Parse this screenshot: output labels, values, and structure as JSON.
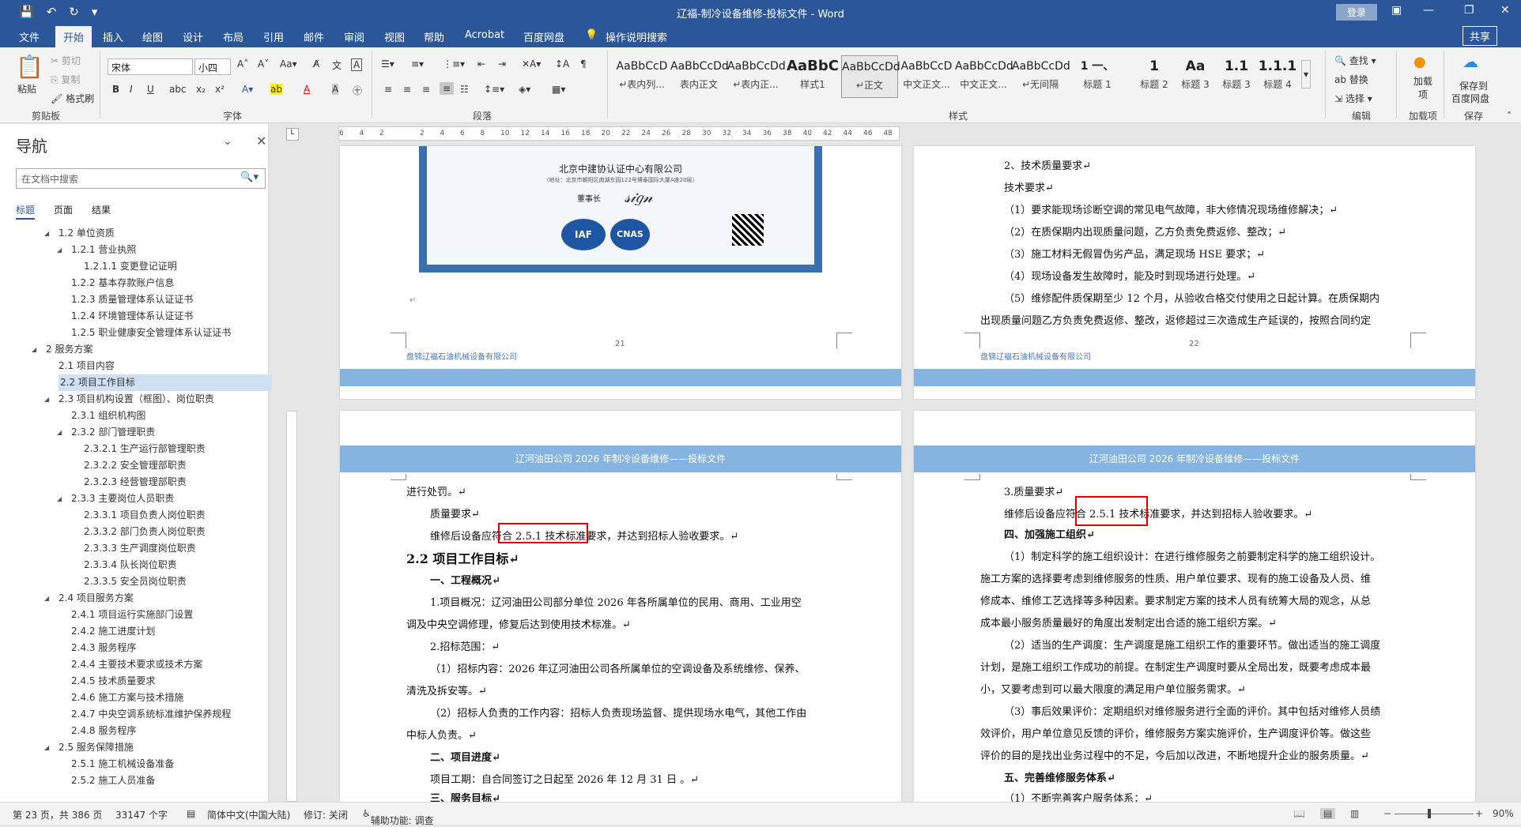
{
  "window": {
    "title": "辽福-制冷设备维修-投标文件 - Word",
    "login": "登录",
    "share": "共享"
  },
  "tabs": [
    "文件",
    "开始",
    "插入",
    "绘图",
    "设计",
    "布局",
    "引用",
    "邮件",
    "审阅",
    "视图",
    "帮助",
    "Acrobat",
    "百度网盘"
  ],
  "tell_me": "操作说明搜索",
  "ribbon": {
    "clipboard": {
      "paste": "粘贴",
      "cut": "剪切",
      "copy": "复制",
      "format_painter": "格式刷",
      "label": "剪贴板"
    },
    "font": {
      "name": "宋体",
      "size": "小四",
      "label": "字体"
    },
    "paragraph": {
      "label": "段落"
    },
    "styles": {
      "label": "样式",
      "items": [
        {
          "preview": "AaBbCcD",
          "name": "↵表内列..."
        },
        {
          "preview": "AaBbCcDd",
          "name": "表内正文"
        },
        {
          "preview": "AaBbCcDd",
          "name": "↵表内正..."
        },
        {
          "preview": "AaBbC",
          "name": "样式1"
        },
        {
          "preview": "AaBbCcDd",
          "name": "↵正文"
        },
        {
          "preview": "AaBbCcD",
          "name": "中文正文..."
        },
        {
          "preview": "AaBbCcDd",
          "name": "中文正文..."
        },
        {
          "preview": "AaBbCcDd",
          "name": "↵无间隔"
        },
        {
          "preview": "1 一、",
          "name": "标题 1"
        },
        {
          "preview": "1",
          "name": "标题 2"
        },
        {
          "preview": "Aa",
          "name": "标题 3"
        },
        {
          "preview": "1.1",
          "name": "标题 3"
        },
        {
          "preview": "1.1.1",
          "name": "标题 4"
        }
      ]
    },
    "editing": {
      "find": "查找",
      "replace": "替换",
      "select": "选择",
      "label": "编辑"
    },
    "addins": {
      "btn": "加载项",
      "label": "加载项"
    },
    "save": {
      "btn1": "保存到",
      "btn2": "百度网盘",
      "label": "保存"
    }
  },
  "nav": {
    "title": "导航",
    "search_placeholder": "在文档中搜索",
    "tabs": [
      "标题",
      "页面",
      "结果"
    ],
    "items": [
      {
        "text": "1.2 单位资质",
        "level": 1,
        "expanded": true
      },
      {
        "text": "1.2.1 营业执照",
        "level": 2,
        "expanded": true
      },
      {
        "text": "1.2.1.1 变更登记证明",
        "level": 3
      },
      {
        "text": "1.2.2 基本存款账户信息",
        "level": 2
      },
      {
        "text": "1.2.3 质量管理体系认证证书",
        "level": 2
      },
      {
        "text": "1.2.4 环境管理体系认证证书",
        "level": 2
      },
      {
        "text": "1.2.5 职业健康安全管理体系认证证书",
        "level": 2
      },
      {
        "text": "2 服务方案",
        "level": 0,
        "expanded": true
      },
      {
        "text": "2.1 项目内容",
        "level": 1
      },
      {
        "text": "2.2 项目工作目标",
        "level": 1,
        "selected": true
      },
      {
        "text": "2.3 项目机构设置（框图）、岗位职责",
        "level": 1,
        "expanded": true
      },
      {
        "text": "2.3.1 组织机构图",
        "level": 2
      },
      {
        "text": "2.3.2 部门管理职责",
        "level": 2,
        "expanded": true
      },
      {
        "text": "2.3.2.1 生产运行部管理职责",
        "level": 3
      },
      {
        "text": "2.3.2.2 安全管理部职责",
        "level": 3
      },
      {
        "text": "2.3.2.3 经营管理部职责",
        "level": 3
      },
      {
        "text": "2.3.3 主要岗位人员职责",
        "level": 2,
        "expanded": true
      },
      {
        "text": "2.3.3.1 项目负责人岗位职责",
        "level": 3
      },
      {
        "text": "2.3.3.2 部门负责人岗位职责",
        "level": 3
      },
      {
        "text": "2.3.3.3 生产调度岗位职责",
        "level": 3
      },
      {
        "text": "2.3.3.4 队长岗位职责",
        "level": 3
      },
      {
        "text": "2.3.3.5 安全员岗位职责",
        "level": 3
      },
      {
        "text": "2.4 项目服务方案",
        "level": 1,
        "expanded": true
      },
      {
        "text": "2.4.1 项目运行实施部门设置",
        "level": 2
      },
      {
        "text": "2.4.2 施工进度计划",
        "level": 2
      },
      {
        "text": "2.4.3 服务程序",
        "level": 2
      },
      {
        "text": "2.4.4 主要技术要求或技术方案",
        "level": 2
      },
      {
        "text": "2.4.5 技术质量要求",
        "level": 2
      },
      {
        "text": "2.4.6 施工方案与技术措施",
        "level": 2
      },
      {
        "text": "2.4.7 中央空调系统标准维护保养规程",
        "level": 2
      },
      {
        "text": "2.4.8 服务程序",
        "level": 2
      },
      {
        "text": "2.5 服务保障措施",
        "level": 1,
        "expanded": true
      },
      {
        "text": "2.5.1 施工机械设备准备",
        "level": 2
      },
      {
        "text": "2.5.2 施工人员准备",
        "level": 2
      }
    ]
  },
  "ruler_ticks": [
    "6",
    "4",
    "2",
    "",
    "2",
    "4",
    "6",
    "8",
    "10",
    "12",
    "14",
    "16",
    "18",
    "20",
    "22",
    "24",
    "26",
    "28",
    "30",
    "32",
    "34",
    "36",
    "38",
    "40",
    "42",
    "44",
    "46",
    "48"
  ],
  "pages": {
    "p21": {
      "cert_company": "北京中建协认证中心有限公司",
      "cert_address": "（地址：北京市朝阳区南湖东园122号博泰国际大厦A座20层）",
      "cert_chairman": "董事长",
      "footer": "盘锦辽福石油机械设备有限公司",
      "number": "21"
    },
    "p22": {
      "lines": [
        "2、技术质量要求↵",
        "技术要求↵",
        "（1）要求能现场诊断空调的常见电气故障，非大修情况现场维修解决；↵",
        "（2）在质保期内出现质量问题，乙方负责免费返修、整改；↵",
        "（3）施工材料无假冒伪劣产品，满足现场 HSE 要求；↵",
        "（4）现场设备发生故障时，能及时到现场进行处理。↵",
        "（5）维修配件质保期至少 12 个月，从验收合格交付使用之日起计算。在质保期内",
        "出现质量问题乙方负责免费返修、整改，返修超过三次造成生产延误的，按照合同约定"
      ],
      "footer": "盘锦辽福石油机械设备有限公司",
      "number": "22"
    },
    "p23": {
      "header": "辽河油田公司 2026 年制冷设备维修——投标文件",
      "lines": [
        "进行处罚。↵",
        "质量要求↵",
        "维修后设备应符合 2.5.1 技术标准要求，并达到招标人验收要求。↵",
        "2.2 项目工作目标↵",
        "一、工程概况↵",
        "1.项目概况：辽河油田公司部分单位 2026 年各所属单位的民用、商用、工业用空",
        "调及中央空调修理，修复后达到使用技术标准。↵",
        "2.招标范围：↵",
        "（1）招标内容：2026 年辽河油田公司各所属单位的空调设备及系统维修、保养、",
        "清洗及拆安等。↵",
        "（2）招标人负责的工作内容：招标人负责现场监督、提供现场水电气，其他工作由",
        "中标人负责。↵",
        "二、项目进度↵",
        "项目工期：自合同签订之日起至 2026 年 12 月 31 日 。↵",
        "三、服务目标↵"
      ]
    },
    "p24": {
      "header": "辽河油田公司 2026 年制冷设备维修——投标文件",
      "lines": [
        "3.质量要求↵",
        "维修后设备应符合 2.5.1 技术标准要求，并达到招标人验收要求。↵",
        "四、加强施工组织↵",
        "（1）制定科学的施工组织设计：在进行维修服务之前要制定科学的施工组织设计。",
        "施工方案的选择要考虑到维修服务的性质、用户单位要求、现有的施工设备及人员、维",
        "修成本、维修工艺选择等多种因素。要求制定方案的技术人员有统筹大局的观念，从总",
        "成本最小服务质量最好的角度出发制定出合适的施工组织方案。↵",
        "（2）适当的生产调度：生产调度是施工组织工作的重要环节。做出适当的施工调度",
        "计划，是施工组织工作成功的前提。在制定生产调度时要从全局出发，既要考虑成本最",
        "小，又要考虑到可以最大限度的满足用户单位服务需求。↵",
        "（3）事后效果评价：定期组织对维修服务进行全面的评价。其中包括对维修人员绩",
        "效评价，用户单位意见反馈的评价，维修服务方案实施评价，生产调度评价等。做这些",
        "评价的目的是找出业务过程中的不足，今后加以改进，不断地提升企业的服务质量。↵",
        "五、完善维修服务体系↵",
        "（1）不断完善客户服务体系：↵"
      ]
    }
  },
  "status": {
    "page": "第 23 页，共 386 页",
    "words": "33147 个字",
    "language": "简体中文(中国大陆)",
    "track": "修订: 关闭",
    "accessibility": "辅助功能: 调查",
    "zoom": "90%"
  }
}
